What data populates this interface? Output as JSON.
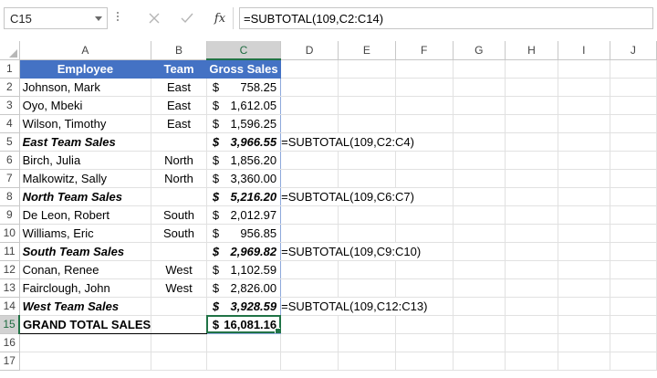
{
  "name_box": {
    "value": "C15"
  },
  "formula_bar": {
    "cancel_icon": "close-icon",
    "enter_icon": "check-icon",
    "fx_label": "fx",
    "formula": "=SUBTOTAL(109,C2:C14)"
  },
  "columns": [
    "A",
    "B",
    "C",
    "D",
    "E",
    "F",
    "G",
    "H",
    "I",
    "J"
  ],
  "rows": [
    "1",
    "2",
    "3",
    "4",
    "5",
    "6",
    "7",
    "8",
    "9",
    "10",
    "11",
    "12",
    "13",
    "14",
    "15",
    "16",
    "17"
  ],
  "header": {
    "employee": "Employee",
    "team": "Team",
    "gross_sales": "Gross Sales"
  },
  "data_rows": [
    {
      "row": "2",
      "employee": "Johnson, Mark",
      "team": "East",
      "currency": "$",
      "sales": "758.25"
    },
    {
      "row": "3",
      "employee": "Oyo, Mbeki",
      "team": "East",
      "currency": "$",
      "sales": "1,612.05"
    },
    {
      "row": "4",
      "employee": "Wilson, Timothy",
      "team": "East",
      "currency": "$",
      "sales": "1,596.25"
    },
    {
      "row": "5",
      "employee": "East Team Sales",
      "team": "",
      "currency": "$",
      "sales": "3,966.55",
      "note": "=SUBTOTAL(109,C2:C4)"
    },
    {
      "row": "6",
      "employee": "Birch, Julia",
      "team": "North",
      "currency": "$",
      "sales": "1,856.20"
    },
    {
      "row": "7",
      "employee": "Malkowitz, Sally",
      "team": "North",
      "currency": "$",
      "sales": "3,360.00"
    },
    {
      "row": "8",
      "employee": "North Team Sales",
      "team": "",
      "currency": "$",
      "sales": "5,216.20",
      "note": "=SUBTOTAL(109,C6:C7)"
    },
    {
      "row": "9",
      "employee": "De Leon, Robert",
      "team": "South",
      "currency": "$",
      "sales": "2,012.97"
    },
    {
      "row": "10",
      "employee": "Williams, Eric",
      "team": "South",
      "currency": "$",
      "sales": "956.85"
    },
    {
      "row": "11",
      "employee": "South Team Sales",
      "team": "",
      "currency": "$",
      "sales": "2,969.82",
      "note": "=SUBTOTAL(109,C9:C10)"
    },
    {
      "row": "12",
      "employee": "Conan, Renee",
      "team": "West",
      "currency": "$",
      "sales": "1,102.59"
    },
    {
      "row": "13",
      "employee": "Fairclough, John",
      "team": "West",
      "currency": "$",
      "sales": "2,826.00"
    },
    {
      "row": "14",
      "employee": "West Team Sales",
      "team": "",
      "currency": "$",
      "sales": "3,928.59",
      "note": "=SUBTOTAL(109,C12:C13)"
    },
    {
      "row": "15",
      "employee": "GRAND TOTAL SALES",
      "team": "",
      "currency": "$",
      "sales": "16,081.16"
    }
  ],
  "colors": {
    "header_fill": "#4472c4",
    "selection": "#217346",
    "table_border": "#8ea9db"
  }
}
